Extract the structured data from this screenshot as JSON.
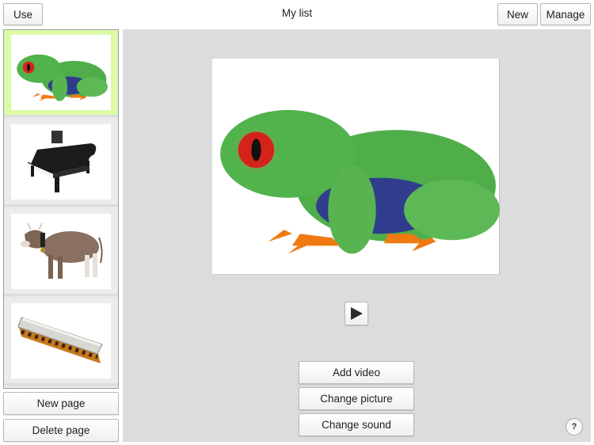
{
  "header": {
    "title": "My list",
    "use_label": "Use",
    "new_label": "New",
    "manage_label": "Manage"
  },
  "sidebar": {
    "pages": [
      {
        "name": "frog",
        "icon": "frog-image",
        "selected": true
      },
      {
        "name": "piano",
        "icon": "grand-piano-image",
        "selected": false
      },
      {
        "name": "cow",
        "icon": "cow-image",
        "selected": false
      },
      {
        "name": "harmonica",
        "icon": "harmonica-image",
        "selected": false
      }
    ],
    "new_page_label": "New page",
    "delete_page_label": "Delete page"
  },
  "main": {
    "picture": "frog-image",
    "play_icon": "play-icon",
    "add_video_label": "Add video",
    "change_picture_label": "Change picture",
    "change_sound_label": "Change sound",
    "help_label": "?"
  },
  "colors": {
    "selected_page": "#dbfba8",
    "main_background": "#dcdcdc",
    "frog_green": "#4fae4a",
    "frog_eye": "#d4231b",
    "frog_feet": "#f07a12"
  }
}
